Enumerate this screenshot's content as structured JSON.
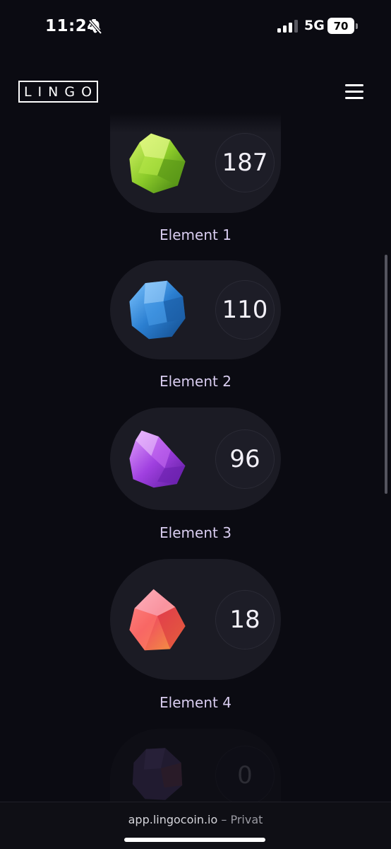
{
  "status_bar": {
    "time": "11:24",
    "network": "5G",
    "battery": "70"
  },
  "header": {
    "logo_text": "LINGO"
  },
  "elements": [
    {
      "label": "Element 1",
      "count": "187",
      "gem": "green-gem-icon",
      "color": "#8bc93a"
    },
    {
      "label": "Element 2",
      "count": "110",
      "gem": "blue-gem-icon",
      "color": "#2f86d6"
    },
    {
      "label": "Element 3",
      "count": "96",
      "gem": "purple-gem-icon",
      "color": "#a646e0"
    },
    {
      "label": "Element 4",
      "count": "18",
      "gem": "red-gem-icon",
      "color": "#e8505b"
    },
    {
      "count": "0",
      "gem": "dark-gem-icon",
      "color": "#4a3a6a"
    }
  ],
  "browser": {
    "url": "app.lingocoin.io",
    "mode": " – Privat"
  }
}
